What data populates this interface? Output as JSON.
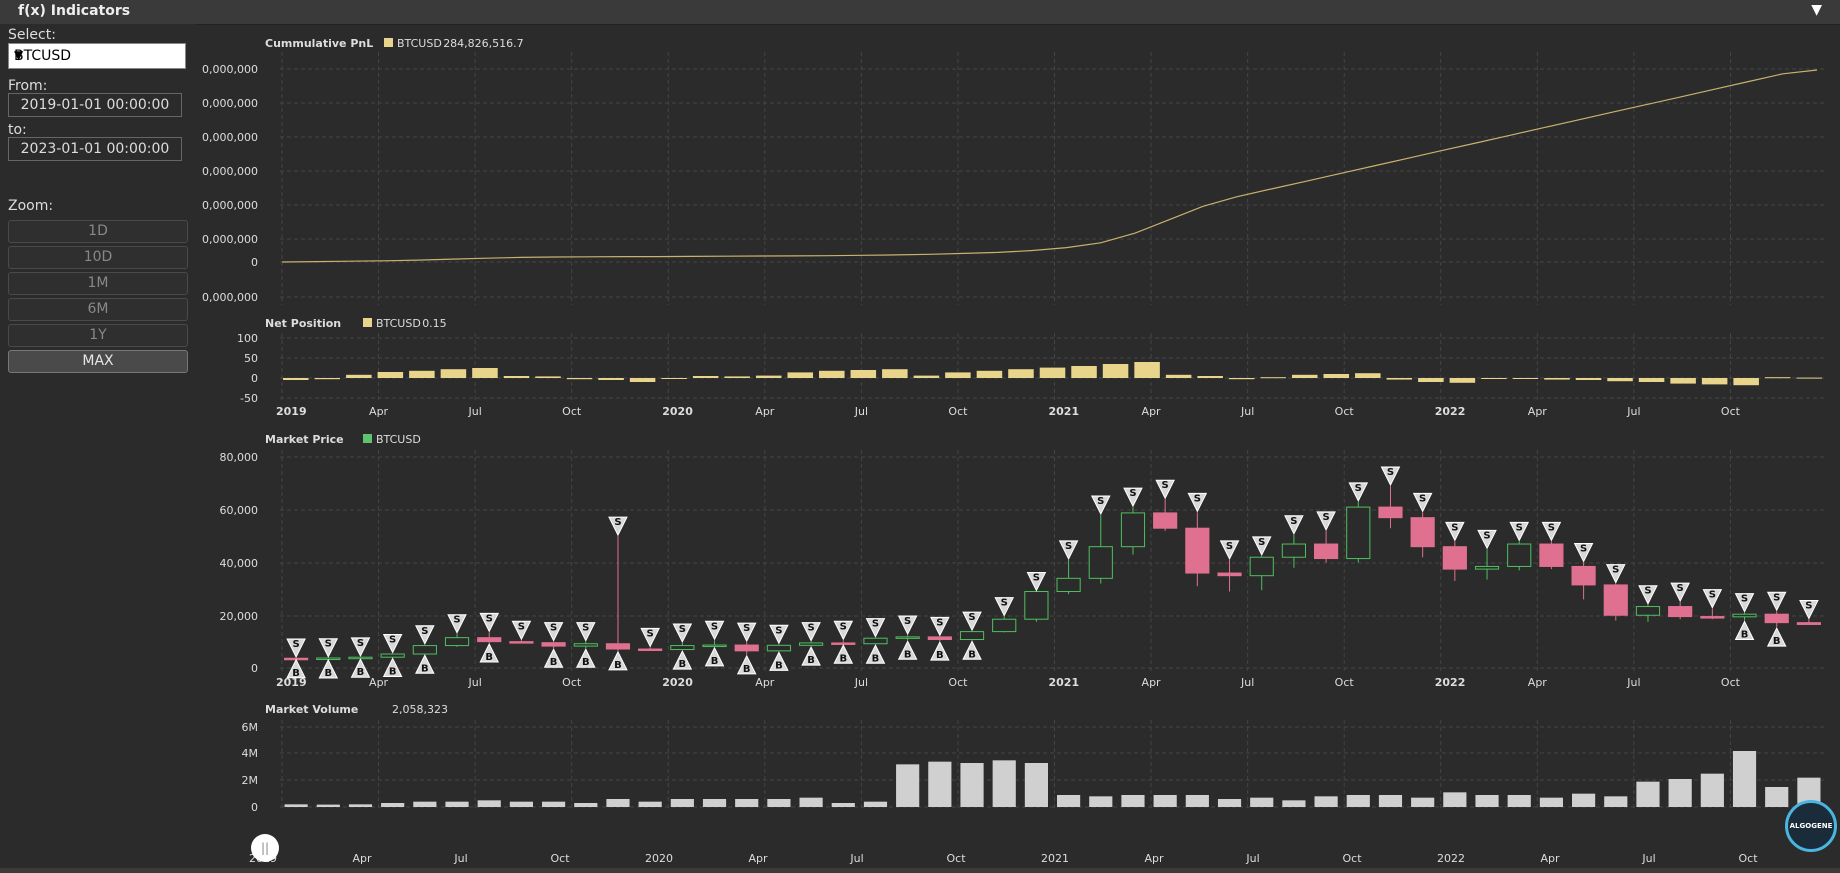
{
  "app": {
    "title": "f(x) Indicators",
    "collapse_icon": "triangle-down-icon"
  },
  "sidebar": {
    "select_label": "Select:",
    "symbol": "BTCUSD",
    "from_label": "From:",
    "from_value": "2019-01-01 00:00:00",
    "to_label": "to:",
    "to_value": "2023-01-01 00:00:00",
    "zoom_label": "Zoom:",
    "zoom_options": [
      "1D",
      "10D",
      "1M",
      "6M",
      "1Y",
      "MAX"
    ],
    "zoom_active": "MAX"
  },
  "logo": {
    "text": "ALGOGENE"
  },
  "time_axis": {
    "ticks": [
      {
        "label": "2019",
        "bold": true
      },
      {
        "label": "Apr",
        "bold": false
      },
      {
        "label": "Jul",
        "bold": false
      },
      {
        "label": "Oct",
        "bold": false
      },
      {
        "label": "2020",
        "bold": true
      },
      {
        "label": "Apr",
        "bold": false
      },
      {
        "label": "Jul",
        "bold": false
      },
      {
        "label": "Oct",
        "bold": false
      },
      {
        "label": "2021",
        "bold": true
      },
      {
        "label": "Apr",
        "bold": false
      },
      {
        "label": "Jul",
        "bold": false
      },
      {
        "label": "Oct",
        "bold": false
      },
      {
        "label": "2022",
        "bold": true
      },
      {
        "label": "Apr",
        "bold": false
      },
      {
        "label": "Jul",
        "bold": false
      },
      {
        "label": "Oct",
        "bold": false
      }
    ]
  },
  "navigator": {
    "ticks": [
      "2019",
      "Apr",
      "Jul",
      "Oct",
      "2020",
      "Apr",
      "Jul",
      "Oct",
      "2021",
      "Apr",
      "Jul",
      "Oct",
      "2022",
      "Apr",
      "Jul",
      "Oct"
    ]
  },
  "chart_data": [
    {
      "type": "line",
      "title": "Cummulative PnL",
      "legend": [
        {
          "name": "BTCUSD",
          "value": "284,826,516.7",
          "color": "#e8d48a"
        }
      ],
      "y_ticks": [
        "0,000,000",
        "0,000,000",
        "0,000,000",
        "0,000,000",
        "0,000,000",
        "0,000,000",
        "0",
        "0,000,000"
      ],
      "series": [
        {
          "name": "BTCUSD",
          "color": "#c8b26e",
          "values": [
            0,
            0.002,
            0.004,
            0.006,
            0.01,
            0.015,
            0.02,
            0.024,
            0.026,
            0.027,
            0.028,
            0.028,
            0.029,
            0.03,
            0.031,
            0.032,
            0.033,
            0.035,
            0.037,
            0.04,
            0.045,
            0.05,
            0.06,
            0.075,
            0.1,
            0.15,
            0.22,
            0.29,
            0.34,
            0.38,
            0.42,
            0.46,
            0.5,
            0.54,
            0.58,
            0.62,
            0.66,
            0.7,
            0.74,
            0.78,
            0.82,
            0.86,
            0.9,
            0.94,
            0.98,
            1.0
          ]
        }
      ]
    },
    {
      "type": "bar",
      "title": "Net Position",
      "legend": [
        {
          "name": "BTCUSD",
          "value": "0.15",
          "color": "#e8d48a"
        }
      ],
      "y_ticks": [
        "100",
        "50",
        "0",
        "-50"
      ],
      "ylim": [
        -50,
        100
      ],
      "series": [
        {
          "name": "BTCUSD",
          "color": "#e8d48a",
          "values": [
            -5,
            -3,
            8,
            15,
            18,
            22,
            25,
            5,
            4,
            -3,
            -5,
            -10,
            0,
            5,
            4,
            6,
            14,
            18,
            20,
            22,
            6,
            14,
            18,
            22,
            26,
            30,
            35,
            40,
            8,
            5,
            -3,
            2,
            8,
            10,
            12,
            -4,
            -10,
            -12,
            -2,
            -1,
            -4,
            -5,
            -8,
            -10,
            -14,
            -16,
            -18,
            2,
            1
          ]
        }
      ]
    },
    {
      "type": "candlestick",
      "title": "Market Price",
      "legend": [
        {
          "name": "BTCUSD",
          "value": "",
          "color": "#5ec46e"
        }
      ],
      "y_ticks": [
        "80,000",
        "60,000",
        "40,000",
        "20,000",
        "0"
      ],
      "ylim": [
        0,
        80000
      ],
      "up_color": "#4fbf5f",
      "down_color": "#e07090",
      "marker_labels": {
        "sell": "S",
        "buy": "B"
      },
      "candles": [
        [
          3700,
          3800,
          3500,
          3600,
          1,
          1
        ],
        [
          3600,
          3900,
          3400,
          3800,
          1,
          1
        ],
        [
          3800,
          4200,
          3700,
          4100,
          1,
          1
        ],
        [
          4100,
          5500,
          4000,
          5300,
          1,
          1
        ],
        [
          5300,
          8800,
          5200,
          8500,
          1,
          1
        ],
        [
          8500,
          13000,
          8000,
          11500,
          1,
          0
        ],
        [
          11500,
          13500,
          9500,
          10000,
          1,
          1
        ],
        [
          10000,
          10500,
          9500,
          9600,
          1,
          0
        ],
        [
          9600,
          10000,
          7500,
          8300,
          1,
          1
        ],
        [
          8300,
          10000,
          7500,
          9200,
          1,
          1
        ],
        [
          9200,
          50000,
          6500,
          7200,
          1,
          1
        ],
        [
          7200,
          7800,
          6800,
          7000,
          1,
          0
        ],
        [
          7000,
          9500,
          6800,
          8500,
          1,
          1
        ],
        [
          8500,
          10500,
          8000,
          8700,
          1,
          1
        ],
        [
          8700,
          9800,
          5000,
          6500,
          1,
          1
        ],
        [
          6500,
          9000,
          6300,
          8600,
          1,
          1
        ],
        [
          8600,
          10000,
          8300,
          9500,
          1,
          1
        ],
        [
          9500,
          10500,
          9000,
          9200,
          1,
          1
        ],
        [
          9200,
          11500,
          9000,
          11300,
          1,
          1
        ],
        [
          11300,
          12500,
          10500,
          11800,
          1,
          1
        ],
        [
          11800,
          12000,
          10200,
          10800,
          1,
          1
        ],
        [
          10800,
          14000,
          10500,
          13800,
          1,
          1
        ],
        [
          13800,
          19500,
          13500,
          18500,
          1,
          0
        ],
        [
          18500,
          29000,
          17500,
          29000,
          1,
          0
        ],
        [
          29000,
          41000,
          28000,
          34000,
          1,
          0
        ],
        [
          34000,
          58000,
          32000,
          46000,
          1,
          0
        ],
        [
          46000,
          61000,
          43000,
          58800,
          1,
          0
        ],
        [
          58800,
          64000,
          52000,
          53000,
          1,
          0
        ],
        [
          53000,
          59000,
          31000,
          36000,
          1,
          0
        ],
        [
          36000,
          41000,
          29000,
          35000,
          1,
          0
        ],
        [
          35000,
          42500,
          29500,
          42000,
          1,
          0
        ],
        [
          42000,
          50500,
          38000,
          47000,
          1,
          0
        ],
        [
          47000,
          52000,
          40000,
          41500,
          1,
          0
        ],
        [
          41500,
          63000,
          40000,
          61000,
          1,
          0
        ],
        [
          61000,
          69000,
          53000,
          57000,
          1,
          0
        ],
        [
          57000,
          59000,
          42000,
          46000,
          1,
          0
        ],
        [
          46000,
          48000,
          33000,
          37500,
          1,
          0
        ],
        [
          37500,
          45000,
          33500,
          38500,
          1,
          0
        ],
        [
          38500,
          48000,
          37000,
          47000,
          1,
          0
        ],
        [
          47000,
          48000,
          37500,
          38500,
          1,
          0
        ],
        [
          38500,
          40000,
          26000,
          31500,
          1,
          0
        ],
        [
          31500,
          32000,
          18000,
          20000,
          1,
          0
        ],
        [
          20000,
          24000,
          17500,
          23300,
          1,
          0
        ],
        [
          23300,
          25000,
          18500,
          19500,
          1,
          0
        ],
        [
          19500,
          22500,
          18500,
          19400,
          1,
          0
        ],
        [
          19400,
          21000,
          18000,
          20400,
          1,
          1
        ],
        [
          20400,
          21500,
          15500,
          17200,
          1,
          1
        ],
        [
          17200,
          18400,
          16300,
          16500,
          1,
          0
        ]
      ]
    },
    {
      "type": "bar",
      "title": "Market Volume",
      "legend": [
        {
          "name": "",
          "value": "2,058,323",
          "color": ""
        }
      ],
      "y_ticks": [
        "6M",
        "4M",
        "2M",
        "0"
      ],
      "ylim": [
        0,
        6000000
      ],
      "series": [
        {
          "name": "Volume",
          "color": "#d0d0d0",
          "values": [
            200000,
            180000,
            200000,
            300000,
            400000,
            400000,
            500000,
            400000,
            400000,
            300000,
            600000,
            400000,
            600000,
            600000,
            600000,
            600000,
            700000,
            300000,
            400000,
            3200000,
            3400000,
            3300000,
            3500000,
            3300000,
            900000,
            800000,
            900000,
            900000,
            900000,
            600000,
            700000,
            500000,
            800000,
            900000,
            900000,
            700000,
            1100000,
            900000,
            900000,
            700000,
            1000000,
            800000,
            1900000,
            2100000,
            2500000,
            4200000,
            1500000,
            2200000
          ]
        }
      ]
    }
  ]
}
